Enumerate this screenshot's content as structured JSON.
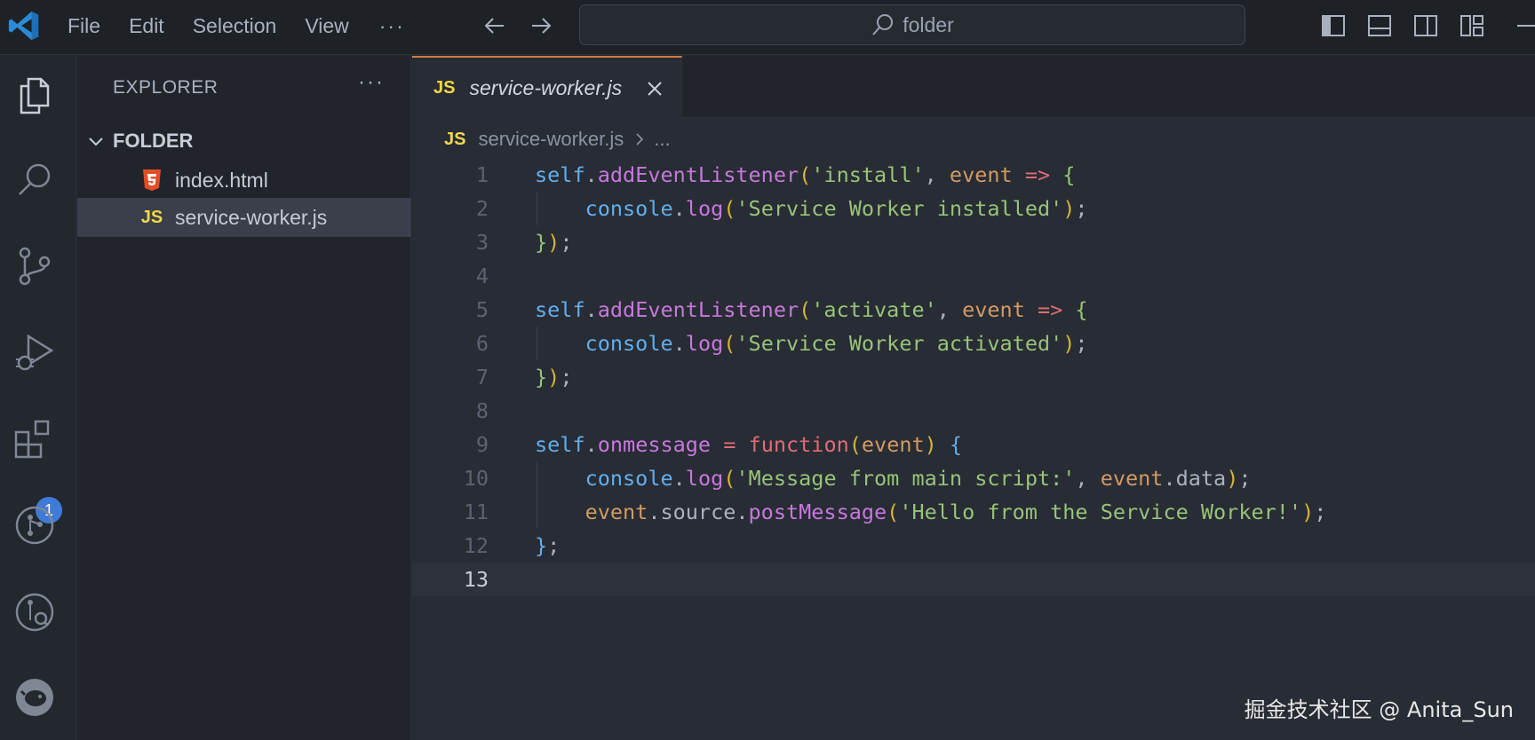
{
  "titlebar": {
    "menu": [
      "File",
      "Edit",
      "Selection",
      "View"
    ],
    "more": "···",
    "search_text": "folder"
  },
  "activity": {
    "extensions_badge": "1"
  },
  "sidebar": {
    "title": "EXPLORER",
    "more": "···",
    "folder_name": "FOLDER",
    "files": [
      {
        "name": "index.html",
        "icon": "html5-icon"
      },
      {
        "name": "service-worker.js",
        "icon": "js-icon",
        "active": true
      }
    ]
  },
  "editor": {
    "tab": {
      "label": "service-worker.js",
      "lang_badge": "JS"
    },
    "breadcrumb": {
      "lang_badge": "JS",
      "file": "service-worker.js",
      "ellipsis": "..."
    },
    "line_numbers": [
      "1",
      "2",
      "3",
      "4",
      "5",
      "6",
      "7",
      "8",
      "9",
      "10",
      "11",
      "12",
      "13"
    ],
    "current_line": 13,
    "code_lines": [
      "self.addEventListener('install', event => {",
      "    console.log('Service Worker installed');",
      "});",
      "",
      "self.addEventListener('activate', event => {",
      "    console.log('Service Worker activated');",
      "});",
      "",
      "self.onmessage = function(event) {",
      "    console.log('Message from main script:', event.data);",
      "    event.source.postMessage('Hello from the Service Worker!');",
      "};",
      ""
    ]
  },
  "watermark": "掘金技术社区 @ Anita_Sun",
  "colors": {
    "accent_tab": "#d17a3f",
    "badge": "#3f7bd6",
    "js_yellow": "#f1d74a",
    "html_orange": "#e44d26"
  }
}
